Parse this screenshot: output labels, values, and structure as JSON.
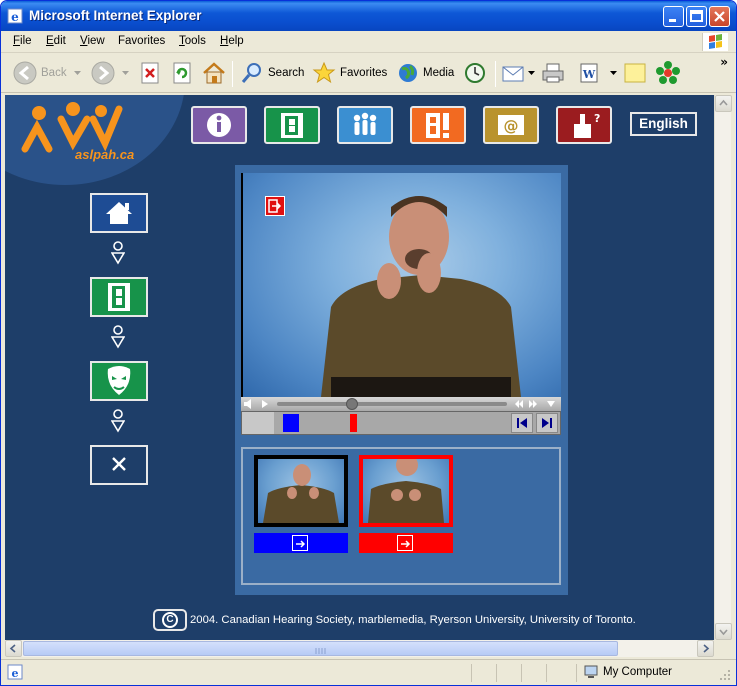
{
  "window": {
    "title": "Microsoft Internet Explorer",
    "minimize_icon": "minimize-icon",
    "maximize_icon": "maximize-icon",
    "close_icon": "close-icon"
  },
  "menu": {
    "items": [
      {
        "label_u": "F",
        "label_rest": "ile"
      },
      {
        "label_u": "E",
        "label_rest": "dit"
      },
      {
        "label_u": "V",
        "label_rest": "iew"
      },
      {
        "label_u": "",
        "label_rest": "Favorites"
      },
      {
        "label_u": "T",
        "label_rest": "ools"
      },
      {
        "label_u": "H",
        "label_rest": "elp"
      }
    ]
  },
  "toolbar": {
    "back": "Back",
    "search": "Search",
    "favorites": "Favorites",
    "media": "Media"
  },
  "site": {
    "logo_text": "aslpah.ca",
    "language_button": "English",
    "nav_icons": [
      "info-icon",
      "book-icon",
      "people-icon",
      "exclamation-icon",
      "email-icon",
      "help-icon"
    ],
    "nav_colors": [
      "#7b5aa6",
      "#17934a",
      "#3b8fd1",
      "#f26a21",
      "#b9932e",
      "#9b1c1f"
    ],
    "side_buttons": [
      "home-icon",
      "book-icon",
      "mask-icon",
      "close-x-icon"
    ],
    "side_colors": [
      "#1e4c94",
      "#17934a",
      "#17934a",
      "#1e3e69"
    ],
    "copyright_symbol": "C",
    "copyright": "2004. Canadian Hearing Society, marblemedia, Ryerson University, University of Toronto."
  },
  "status": {
    "zone": "My Computer"
  }
}
